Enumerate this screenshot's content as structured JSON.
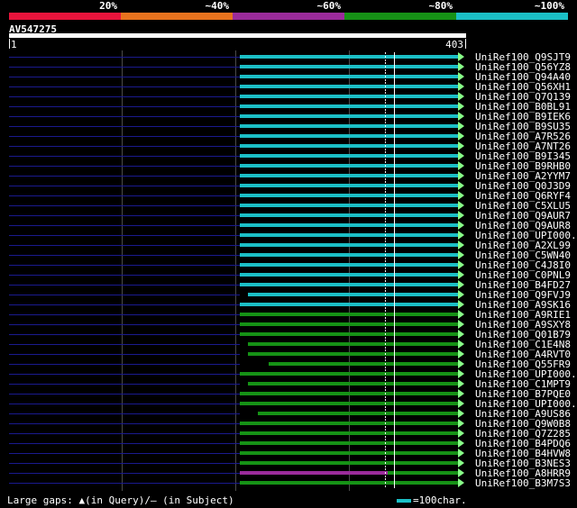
{
  "legend": {
    "segments": [
      {
        "label": "20%",
        "color": "#e8143c"
      },
      {
        "label": "~40%",
        "color": "#e8731e"
      },
      {
        "label": "~60%",
        "color": "#9b2b9b"
      },
      {
        "label": "~80%",
        "color": "#169216"
      },
      {
        "label": "~100%",
        "color": "#1bbfc6"
      }
    ]
  },
  "query": {
    "title": "AV547275",
    "start": "1",
    "end": "403"
  },
  "hit_colors": {
    "cyan": "#1bbfc6",
    "green": "#169216",
    "purple": "#9b2b9b",
    "line": "#1a1a8e"
  },
  "hits": [
    {
      "name": "UniRef100_Q9SJT9",
      "color": "cyan"
    },
    {
      "name": "UniRef100_Q56YZ8",
      "color": "cyan"
    },
    {
      "name": "UniRef100_Q94A40",
      "color": "cyan"
    },
    {
      "name": "UniRef100_Q56XH1",
      "color": "cyan"
    },
    {
      "name": "UniRef100_Q7Q139",
      "color": "cyan"
    },
    {
      "name": "UniRef100_B0BL91",
      "color": "cyan"
    },
    {
      "name": "UniRef100_B9IEK6",
      "color": "cyan"
    },
    {
      "name": "UniRef100_B9SU35",
      "color": "cyan"
    },
    {
      "name": "UniRef100_A7R526",
      "color": "cyan"
    },
    {
      "name": "UniRef100_A7NT26",
      "color": "cyan"
    },
    {
      "name": "UniRef100_B9I345",
      "color": "cyan"
    },
    {
      "name": "UniRef100_B9RHB0",
      "color": "cyan"
    },
    {
      "name": "UniRef100_A2YYM7",
      "color": "cyan"
    },
    {
      "name": "UniRef100_Q0J3D9",
      "color": "cyan"
    },
    {
      "name": "UniRef100_Q6RYF4",
      "color": "cyan"
    },
    {
      "name": "UniRef100_C5XLU5",
      "color": "cyan"
    },
    {
      "name": "UniRef100_Q9AUR7",
      "color": "cyan"
    },
    {
      "name": "UniRef100_Q9AUR8",
      "color": "cyan"
    },
    {
      "name": "UniRef100_UPI000..",
      "color": "cyan"
    },
    {
      "name": "UniRef100_A2XL99",
      "color": "cyan"
    },
    {
      "name": "UniRef100_C5WN40",
      "color": "cyan"
    },
    {
      "name": "UniRef100_C4J8I0",
      "color": "cyan"
    },
    {
      "name": "UniRef100_C0PNL9",
      "color": "cyan"
    },
    {
      "name": "UniRef100_B4FD27",
      "color": "cyan"
    },
    {
      "name": "UniRef100_Q9FVJ9",
      "color": "cyan"
    },
    {
      "name": "UniRef100_A9SK16",
      "color": "cyan"
    },
    {
      "name": "UniRef100_A9RIE1",
      "color": "green"
    },
    {
      "name": "UniRef100_A9SXY8",
      "color": "green"
    },
    {
      "name": "UniRef100_Q01B79",
      "color": "green"
    },
    {
      "name": "UniRef100_C1E4N8",
      "color": "green"
    },
    {
      "name": "UniRef100_A4RVT0",
      "color": "green"
    },
    {
      "name": "UniRef100_Q55FR9",
      "color": "green"
    },
    {
      "name": "UniRef100_UPI000..",
      "color": "green"
    },
    {
      "name": "UniRef100_C1MPT9",
      "color": "green"
    },
    {
      "name": "UniRef100_B7PQE0",
      "color": "green"
    },
    {
      "name": "UniRef100_UPI000..",
      "color": "green"
    },
    {
      "name": "UniRef100_A9US86",
      "color": "green"
    },
    {
      "name": "UniRef100_Q9W0B8",
      "color": "green"
    },
    {
      "name": "UniRef100_Q7Z285",
      "color": "green"
    },
    {
      "name": "UniRef100_B4PDQ6",
      "color": "green"
    },
    {
      "name": "UniRef100_B4HVW8",
      "color": "green"
    },
    {
      "name": "UniRef100_B3NES3",
      "color": "green"
    },
    {
      "name": "UniRef100_A8HRR9",
      "color": "purple"
    },
    {
      "name": "UniRef100_B3M7S3",
      "color": "green"
    }
  ],
  "footer": {
    "gaps_text": "Large gaps: ▲(in Query)/– (in Subject)",
    "scale_text": "=100char."
  }
}
